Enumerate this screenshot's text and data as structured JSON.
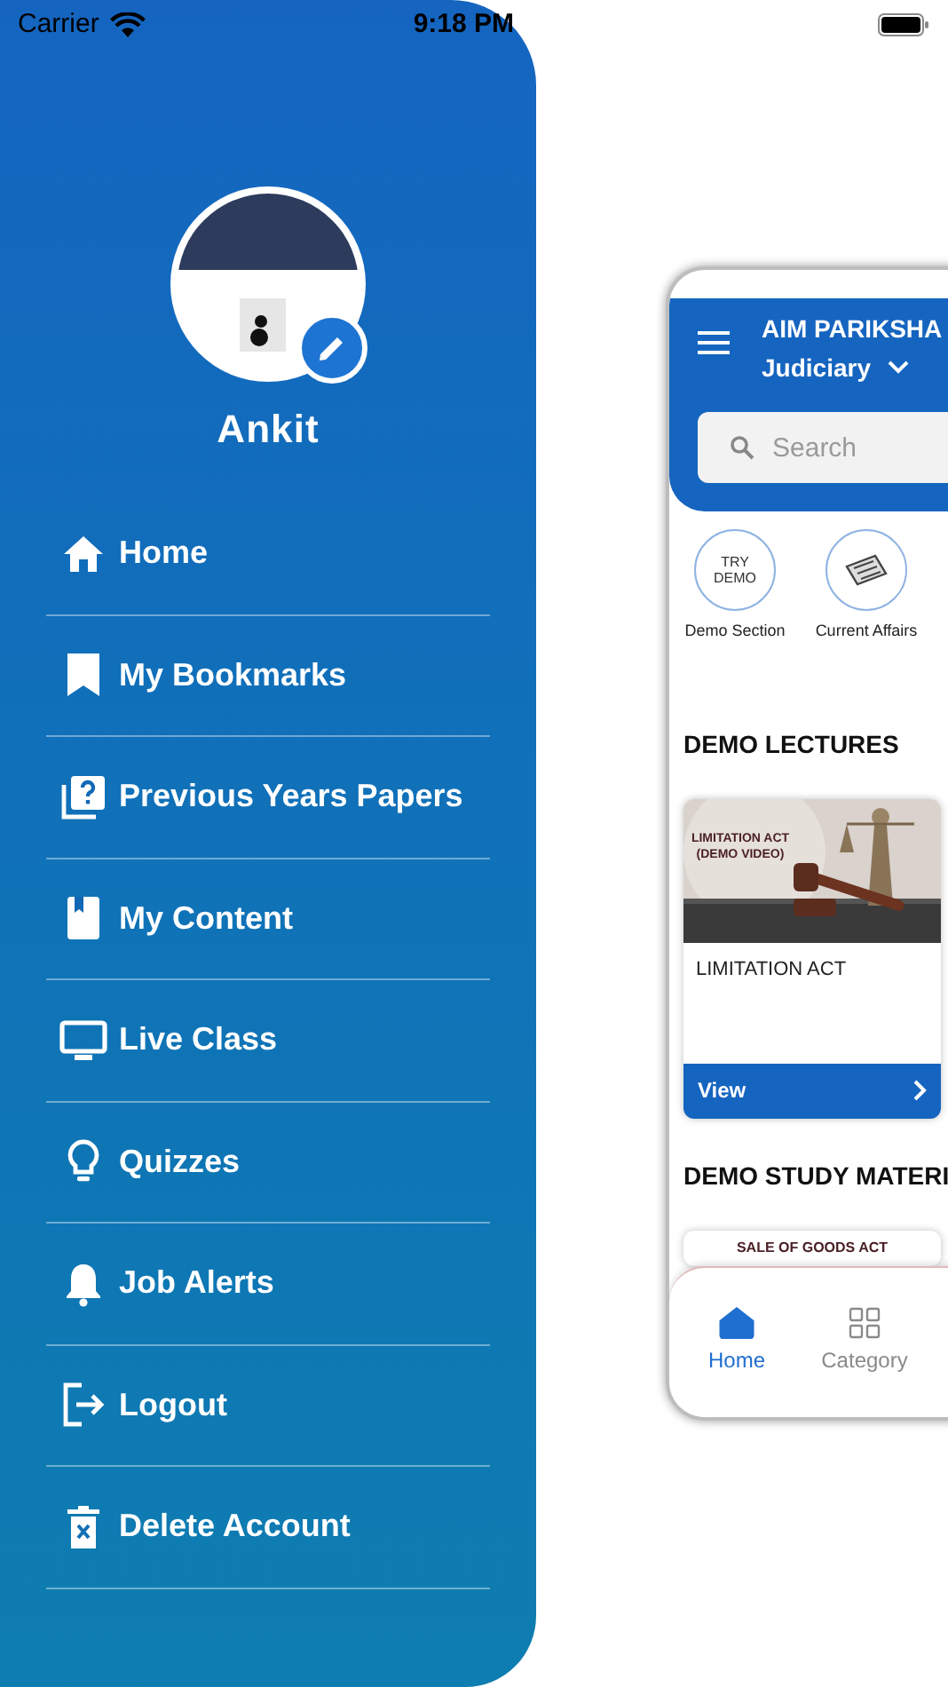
{
  "status_bar": {
    "carrier": "Carrier",
    "time": "9:18 PM"
  },
  "drawer": {
    "user_name": "Ankit",
    "items": [
      {
        "label": "Home"
      },
      {
        "label": "My Bookmarks"
      },
      {
        "label": "Previous Years Papers"
      },
      {
        "label": "My Content"
      },
      {
        "label": "Live Class"
      },
      {
        "label": "Quizzes"
      },
      {
        "label": "Job Alerts"
      },
      {
        "label": "Logout"
      },
      {
        "label": "Delete Account"
      }
    ]
  },
  "app_preview": {
    "title": "AIM PARIKSHA",
    "category": "Judiciary",
    "search": {
      "placeholder": "Search"
    },
    "shortcuts": [
      {
        "label": "Demo Section",
        "icon_text": "TRY DEMO"
      },
      {
        "label": "Current Affairs"
      }
    ],
    "sections": [
      {
        "title": "DEMO LECTURES",
        "card": {
          "thumbnail_caption": "LIMITATION ACT (DEMO VIDEO)",
          "title": "LIMITATION ACT",
          "action": "View"
        }
      },
      {
        "title": "DEMO STUDY MATERI",
        "card": {
          "thumbnail_caption": "SALE OF GOODS ACT"
        }
      }
    ],
    "bottom_nav": [
      {
        "label": "Home",
        "selected": true
      },
      {
        "label": "Category",
        "selected": false
      }
    ]
  }
}
